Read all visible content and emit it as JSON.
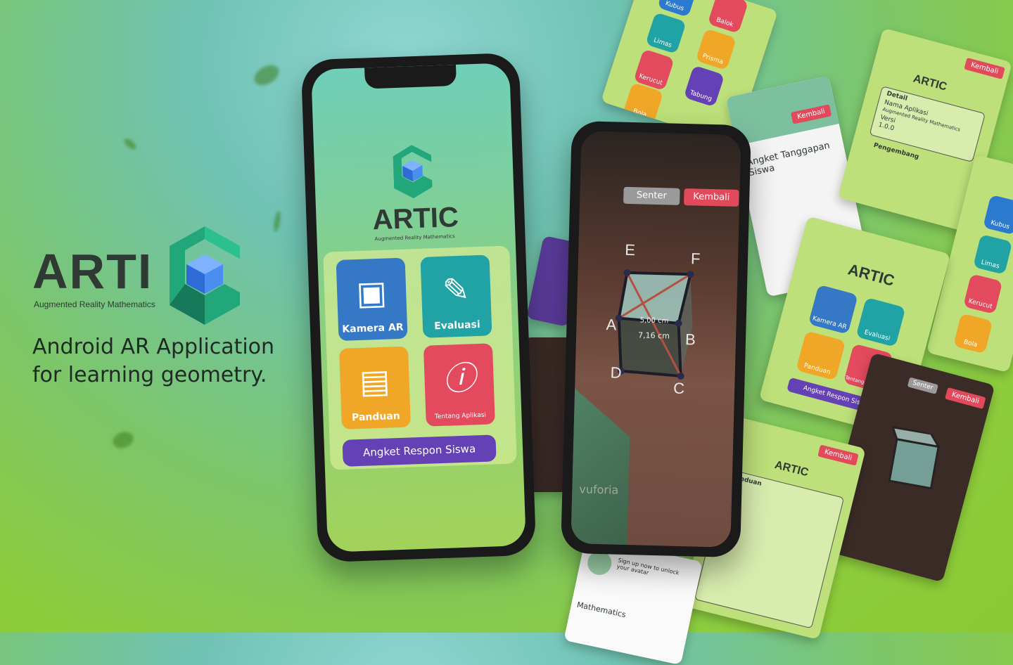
{
  "hero": {
    "logo_word": "ARTI",
    "logo_subtitle": "Augmented Reality Mathematics",
    "tagline_line1": "Android AR Application",
    "tagline_line2": "for learning geometry."
  },
  "main_phone": {
    "app_name": "ARTIC",
    "app_subtitle": "Augmented Reality Mathematics",
    "tiles": [
      {
        "label": "Kamera AR",
        "icon": "qr-scan-icon",
        "color": "#3478c6"
      },
      {
        "label": "Evaluasi",
        "icon": "document-edit-icon",
        "color": "#21a3a6"
      },
      {
        "label": "Panduan",
        "icon": "book-icon",
        "color": "#f0a627"
      },
      {
        "label": "Tentang Aplikasi",
        "icon": "info-icon",
        "color": "#e34a5e"
      }
    ],
    "survey_button": "Angket Respon Siswa"
  },
  "ar_phone": {
    "senter": "Senter",
    "kembali": "Kembali",
    "vertices": [
      "E",
      "F",
      "A",
      "B",
      "D",
      "C"
    ],
    "measure_top": "5,00 cm",
    "measure_mid": "7,16 cm",
    "brand": "vuforia"
  },
  "side": {
    "shapes_top": [
      "Kubus",
      "Balok",
      "Limas",
      "Prisma",
      "Kerucut",
      "Tabung",
      "Bola"
    ],
    "kembali": "Kembali",
    "angket_title": "Angket Tanggapan Siswa",
    "detail_title": "Detail",
    "detail_app": "Nama Aplikasi",
    "detail_app_value": "Augmented Reality Mathematics",
    "detail_version": "Versi",
    "detail_version_value": "1.0.0",
    "pengembang": "Pengembang",
    "panduan_title": "Panduan",
    "signup": "Sign up now to unlock your avatar",
    "mathematics": "Mathematics",
    "artic": "ARTIC",
    "mini_menu": [
      "Kamera AR",
      "Evaluasi",
      "Panduan",
      "Tentang Aplikasi"
    ],
    "mini_survey": "Angket Respon Siswa",
    "shapes_right": [
      "Kubus",
      "Limas",
      "Kerucut",
      "Bola"
    ]
  }
}
